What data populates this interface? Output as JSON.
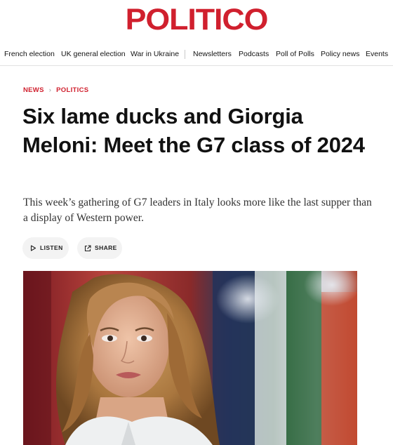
{
  "brand": {
    "logo_text": "POLITICO",
    "accent_color": "#d0202e"
  },
  "nav": {
    "items": [
      {
        "label": "French election"
      },
      {
        "label": "UK general election"
      },
      {
        "label": "War in Ukraine"
      },
      {
        "label": "Newsletters"
      },
      {
        "label": "Podcasts"
      },
      {
        "label": "Poll of Polls"
      },
      {
        "label": "Policy news"
      },
      {
        "label": "Events"
      }
    ]
  },
  "breadcrumb": {
    "items": [
      {
        "label": "NEWS"
      },
      {
        "label": "POLITICS"
      }
    ],
    "separator": "›"
  },
  "article": {
    "headline": "Six lame ducks and Giorgia Meloni: Meet the G7 class of 2024",
    "dek": "This week’s gathering of G7 leaders in Italy looks more like the last supper than a display of Western power."
  },
  "actions": {
    "listen_label": "LISTEN",
    "listen_icon": "play-icon",
    "share_label": "SHARE",
    "share_icon": "share-icon"
  },
  "hero_image": {
    "subject": "photo"
  }
}
